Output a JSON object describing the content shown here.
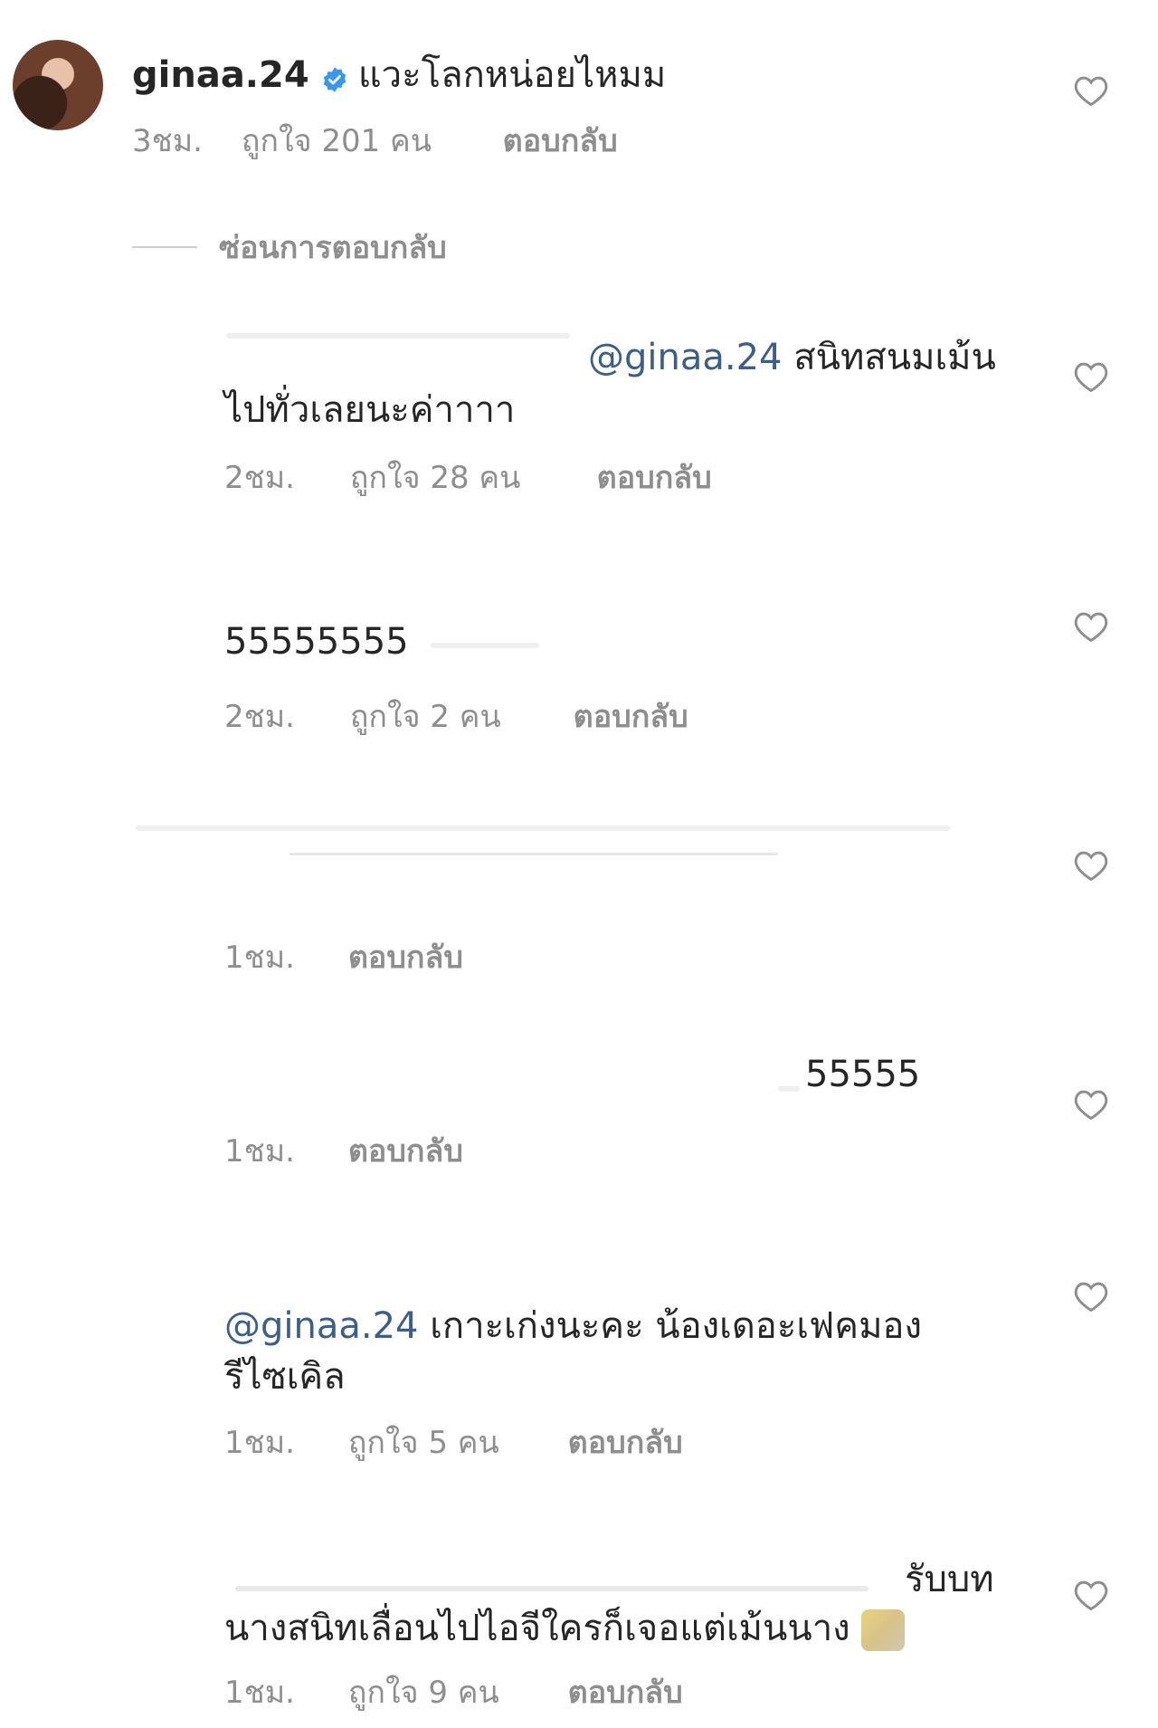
{
  "parent_comment": {
    "username": "ginaa.24",
    "text": "แวะโลกหน่อยไหมม",
    "time": "3ชม.",
    "likes": "ถูกใจ 201 คน",
    "reply_label": "ตอบกลับ"
  },
  "hide_replies_label": "ซ่อนการตอบกลับ",
  "replies": [
    {
      "mention": "@ginaa.24",
      "text_line1": "สนิทสนมเม้น",
      "text_line2": "ไปทั่วเลยนะค่าาาา",
      "time": "2ชม.",
      "likes": "ถูกใจ 28 คน",
      "reply_label": "ตอบกลับ"
    },
    {
      "text": "55555555",
      "time": "2ชม.",
      "likes": "ถูกใจ 2 คน",
      "reply_label": "ตอบกลับ"
    },
    {
      "time": "1ชม.",
      "reply_label": "ตอบกลับ"
    },
    {
      "text": "55555",
      "time": "1ชม.",
      "reply_label": "ตอบกลับ"
    },
    {
      "mention": "@ginaa.24",
      "text_line1": "เกาะเก่งนะคะ น้องเดอะเฟคมอง",
      "text_line2": "รีไซเคิล",
      "time": "1ชม.",
      "likes": "ถูกใจ 5 คน",
      "reply_label": "ตอบกลับ"
    },
    {
      "text_line1": "รับบท",
      "text_line2": "นางสนิทเลื่อนไปไอจีใครก็เจอแต่เม้นนาง",
      "time": "1ชม.",
      "likes": "ถูกใจ 9 คน",
      "reply_label": "ตอบกลับ"
    }
  ],
  "icons": {
    "like": "heart-outline-icon",
    "verified": "verified-badge-icon"
  },
  "colors": {
    "text": "#262626",
    "meta": "#8e8e8e",
    "mention": "#3b5f8a",
    "verified": "#3897f0"
  }
}
